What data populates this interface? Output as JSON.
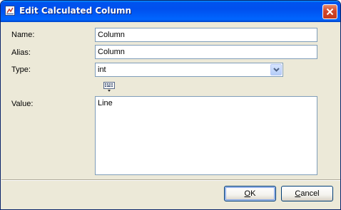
{
  "window": {
    "title": "Edit Calculated Column"
  },
  "form": {
    "name": {
      "label": "Name:",
      "value": "Column"
    },
    "alias": {
      "label": "Alias:",
      "value": "Column"
    },
    "type": {
      "label": "Type:",
      "value": "int"
    },
    "value": {
      "label": "Value:",
      "text": "Line"
    }
  },
  "buttons": {
    "ok": {
      "mnemonic": "O",
      "rest": "K"
    },
    "cancel": {
      "mnemonic": "C",
      "rest": "ancel"
    }
  },
  "colors": {
    "titlebar": "#0055e5",
    "dialog_bg": "#ece9d8",
    "field_border": "#7f9db9",
    "close": "#c33a1c"
  }
}
